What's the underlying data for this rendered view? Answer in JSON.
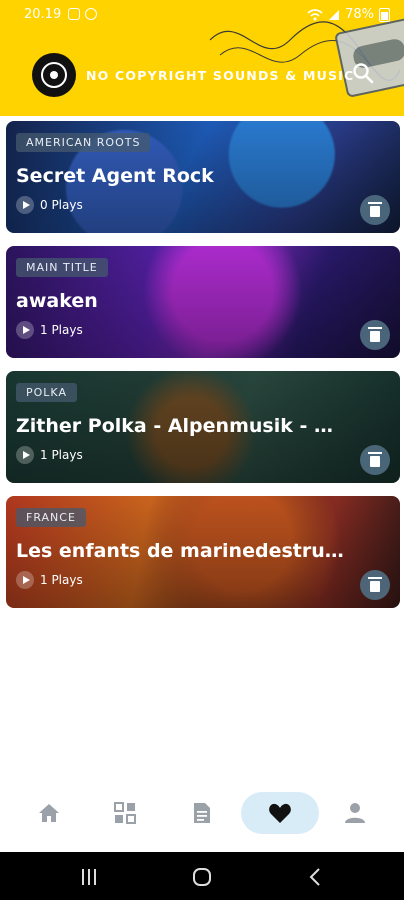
{
  "status_bar": {
    "time": "20.19",
    "battery": "78%"
  },
  "header": {
    "app_title": "NO COPYRIGHT SOUNDS & MUSIC"
  },
  "tracks": [
    {
      "tag": "AMERICAN ROOTS",
      "title": "Secret Agent Rock",
      "plays": "0 Plays"
    },
    {
      "tag": "MAIN TITLE",
      "title": "awaken",
      "plays": "1 Plays"
    },
    {
      "tag": "POLKA",
      "title": "Zither Polka - Alpenmusik - Mus...",
      "plays": "1 Plays"
    },
    {
      "tag": "FRANCE",
      "title": "Les enfants de marinedestructi...",
      "plays": "1 Plays"
    }
  ],
  "bottom_nav": {
    "items": [
      "home-icon",
      "grid-icon",
      "document-icon",
      "heart-icon",
      "user-icon"
    ],
    "active": "heart-icon",
    "active_color": "#d8ecf7"
  },
  "colors": {
    "header_bg": "#ffd300",
    "icon_gray": "#9aa1a8"
  }
}
